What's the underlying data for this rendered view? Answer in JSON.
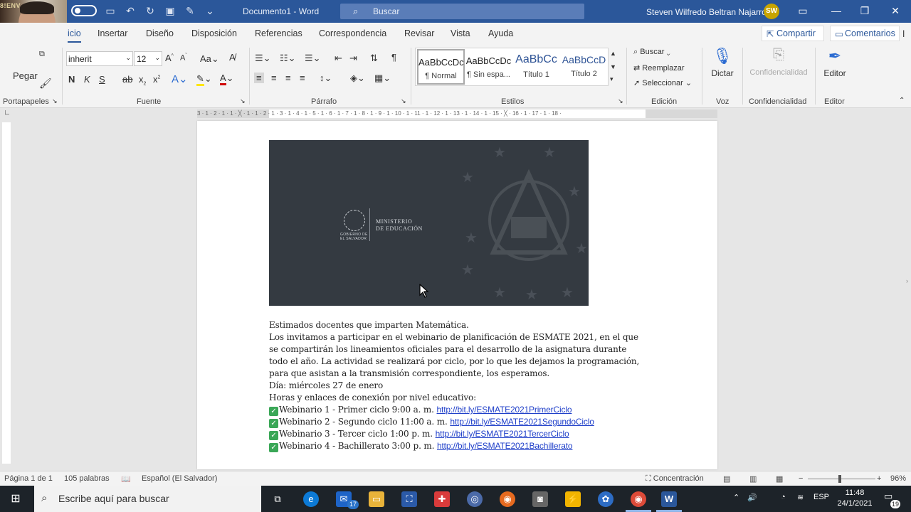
{
  "titlebar": {
    "doc_title": "Documento1  -  Word",
    "search_placeholder": "Buscar",
    "user_name": "Steven Wilfredo Beltran Najarro",
    "user_initials": "SW"
  },
  "webcam": {
    "tag": "8!ENV"
  },
  "tabs": [
    "Inicio",
    "Insertar",
    "Diseño",
    "Disposición",
    "Referencias",
    "Correspondencia",
    "Revisar",
    "Vista",
    "Ayuda"
  ],
  "active_tab_visible": "icio",
  "share_label": "Compartir",
  "comments_label": "Comentarios",
  "ribbon": {
    "paste_label": "Pegar",
    "font_name": "inherit",
    "font_size": "12",
    "bold": "N",
    "italic": "K",
    "underline": "S",
    "styles": [
      {
        "preview": "AaBbCcDc",
        "name": "¶ Normal"
      },
      {
        "preview": "AaBbCcDc",
        "name": "¶ Sin espa..."
      },
      {
        "preview": "AaBbCc",
        "name": "Título 1"
      },
      {
        "preview": "AaBbCcD",
        "name": "Título 2"
      }
    ],
    "find_label": "Buscar",
    "replace_label": "Reemplazar",
    "select_label": "Seleccionar",
    "dictate_label": "Dictar",
    "confidential_label": "Confidencialidad",
    "editor_label": "Editor",
    "groups": {
      "clipboard": "Portapapeles",
      "font": "Fuente",
      "paragraph": "Párrafo",
      "styles": "Estilos",
      "editing": "Edición",
      "voice": "Voz",
      "sensitivity": "Confidencialidad",
      "editor": "Editor"
    }
  },
  "ruler_marks": "3 · 1 · 2 · 1 · 1 · ╳ · 1 · 1 · 2 · 1 · 3 · 1 · 4 · 1 · 5 · 1 · 6 · 1 · 7 · 1 · 8 · 1 · 9 · 1 · 10 · 1 · 11 · 1 · 12 · 1 · 13 · 1 · 14 · 1 · 15 · ╳ · 16 · 1 · 17 · 1 · 18 ·",
  "banner": {
    "ministry_line1": "MINISTERIO",
    "ministry_line2": "DE EDUCACIÓN",
    "gov_line1": "GOBIERNO DE",
    "gov_line2": "EL SALVADOR"
  },
  "document": {
    "lines": [
      "Estimados docentes que imparten Matemática.",
      "Los invitamos a participar en el webinario de planificación de ESMATE 2021, en el que",
      "se compartirán los lineamientos oficiales para el desarrollo de la asignatura durante",
      "todo el año. La actividad se realizará por ciclo, por lo que les dejamos la programación,",
      "para que asistan a la transmisión correspondiente, los esperamos.",
      "Día: miércoles 27 de enero",
      "Horas y enlaces de conexión por nivel educativo:"
    ],
    "webinars": [
      {
        "text": "Webinario 1 - Primer ciclo 9:00 a. m. ",
        "link": "http://bit.ly/ESMATE2021PrimerCiclo"
      },
      {
        "text": "Webinario 2 - Segundo ciclo 11:00 a. m. ",
        "link": "http://bit.ly/ESMATE2021SegundoCiclo"
      },
      {
        "text": "Webinario 3 - Tercer ciclo 1:00 p. m. ",
        "link": "http://bit.ly/ESMATE2021TercerCiclo"
      },
      {
        "text": "Webinario 4 - Bachillerato 3:00 p. m. ",
        "link": "http://bit.ly/ESMATE2021Bachillerato"
      }
    ]
  },
  "statusbar": {
    "page": "Página 1 de 1",
    "words": "105 palabras",
    "language": "Español (El Salvador)",
    "focus": "Concentración",
    "zoom": "96%"
  },
  "taskbar": {
    "search_placeholder": "Escribe aquí para buscar",
    "mail_badge": "17",
    "lang": "ESP",
    "time": "11:48",
    "date": "24/1/2021",
    "notif_count": "19"
  }
}
